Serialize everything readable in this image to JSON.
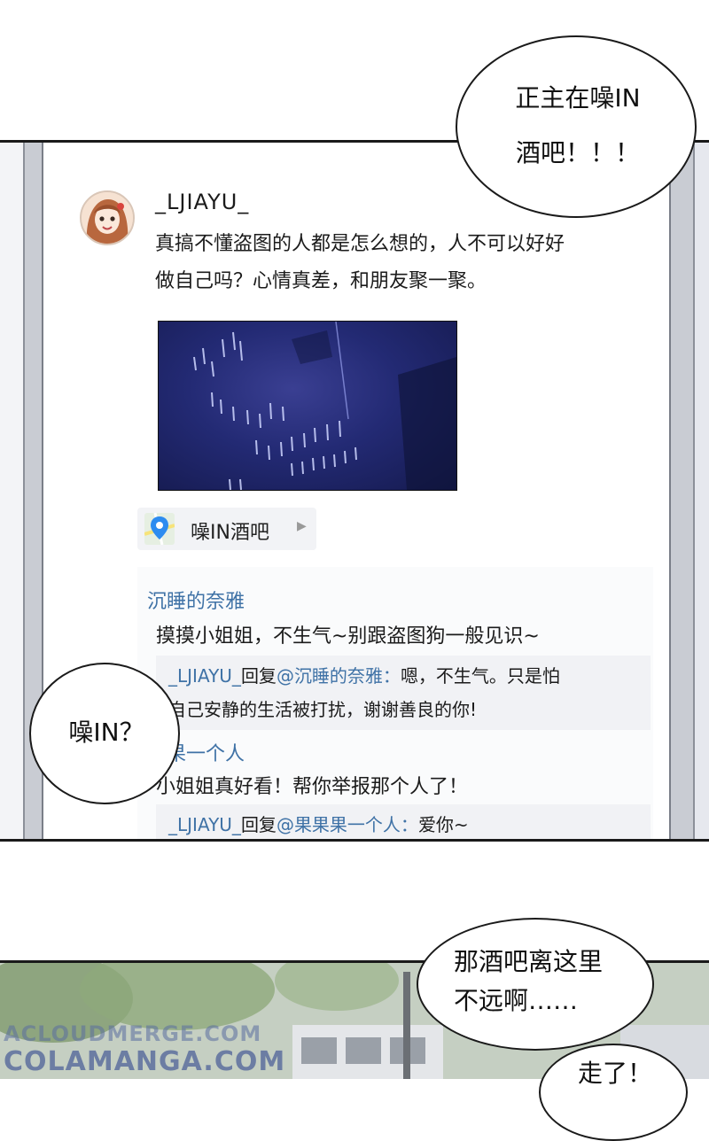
{
  "post": {
    "username": "_LJIAYU_",
    "text_line1": "真搞不懂盗图的人都是怎么想的，人不可以好好",
    "text_line2": "做自己吗？心情真差，和朋友聚一聚。",
    "location": "噪IN酒吧"
  },
  "comments": [
    {
      "name": "沉睡的奈雅",
      "text": "摸摸小姐姐，不生气~别跟盗图狗一般见识~",
      "reply": {
        "user": "_LJIAYU_",
        "mid": "回复",
        "target": "@沉睡的奈雅：",
        "text_line1": "嗯，不生气。只是怕",
        "text_line2": "自己安静的生活被打扰，谢谢善良的你!"
      }
    },
    {
      "name": "果果一个人",
      "text": "小姐姐真好看！帮你举报那个人了！",
      "reply": {
        "user": "_LJIAYU_",
        "mid": "回复",
        "target": "@果果果一个人：",
        "text": "爱你~"
      }
    }
  ],
  "bubbles": {
    "top_right_line1": "正主在噪IN",
    "top_right_line2": "酒吧！！！",
    "left": "噪IN？",
    "bottom_right_line1": "那酒吧离这里",
    "bottom_right_line2": "不远啊……",
    "bottom_partial": "走了！"
  },
  "watermark": {
    "line1": "ACLOUDMERGE.COM",
    "line2": "COLAMANGA.COM"
  },
  "colors": {
    "link_blue": "#3f72a6",
    "image_navy": "#232a74",
    "location_pin": "#2d8cf0"
  },
  "icons": [
    "location-pin-icon",
    "chevron-right-icon"
  ]
}
